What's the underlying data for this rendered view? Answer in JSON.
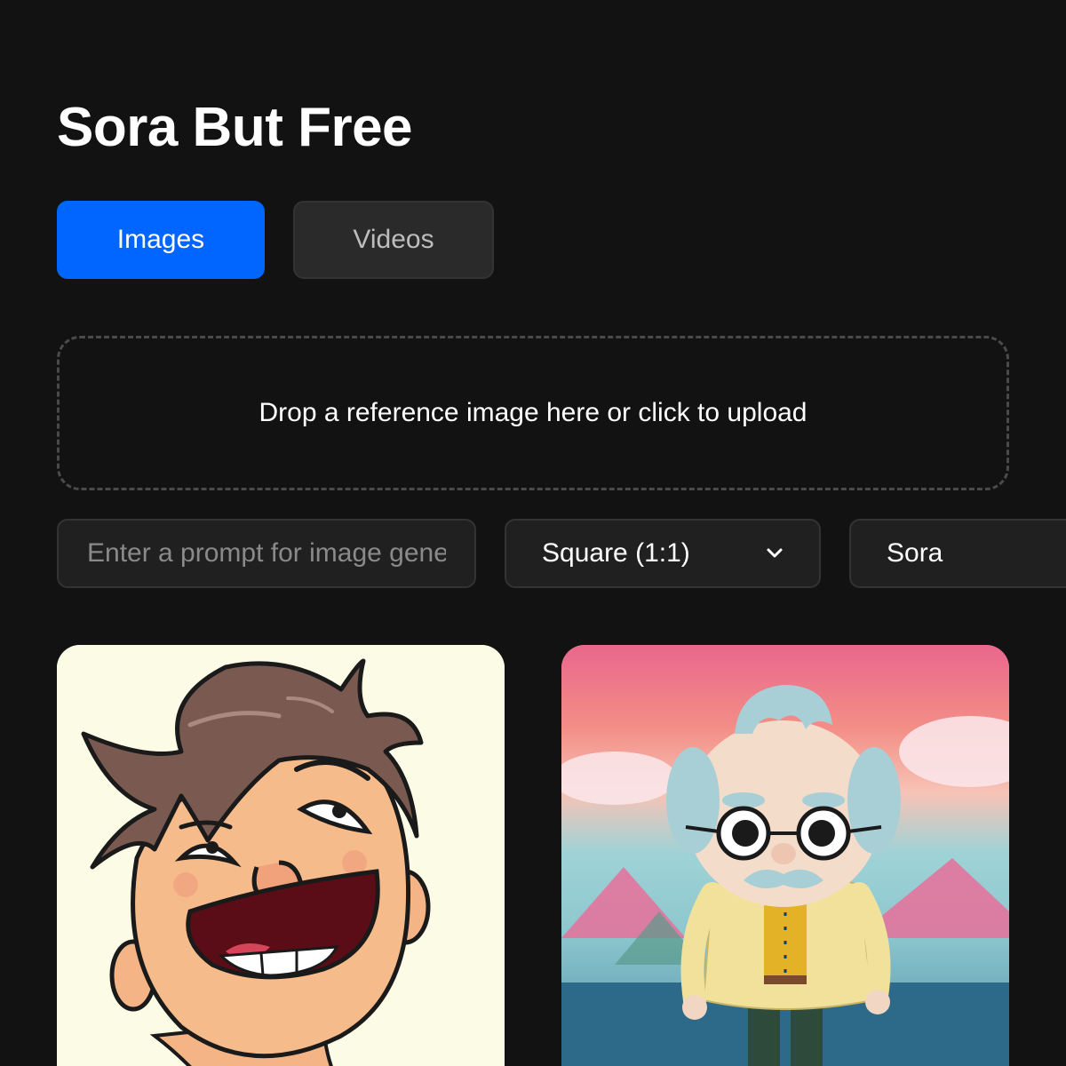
{
  "header": {
    "title": "Sora But Free"
  },
  "tabs": [
    {
      "label": "Images",
      "active": true
    },
    {
      "label": "Videos",
      "active": false
    }
  ],
  "upload": {
    "text": "Drop a reference image here or click to upload"
  },
  "controls": {
    "prompt_placeholder": "Enter a prompt for image generation",
    "prompt_value": "",
    "aspect_ratio": "Square (1:1)",
    "model": "Sora"
  },
  "gallery": [
    {
      "description_icon": "cartoon-laughing-boy-image"
    },
    {
      "description_icon": "old-man-toy-figurine-image"
    }
  ],
  "colors": {
    "background": "#121212",
    "accent": "#0066ff",
    "tab_inactive": "#2a2a2a",
    "field_bg": "#202020"
  }
}
